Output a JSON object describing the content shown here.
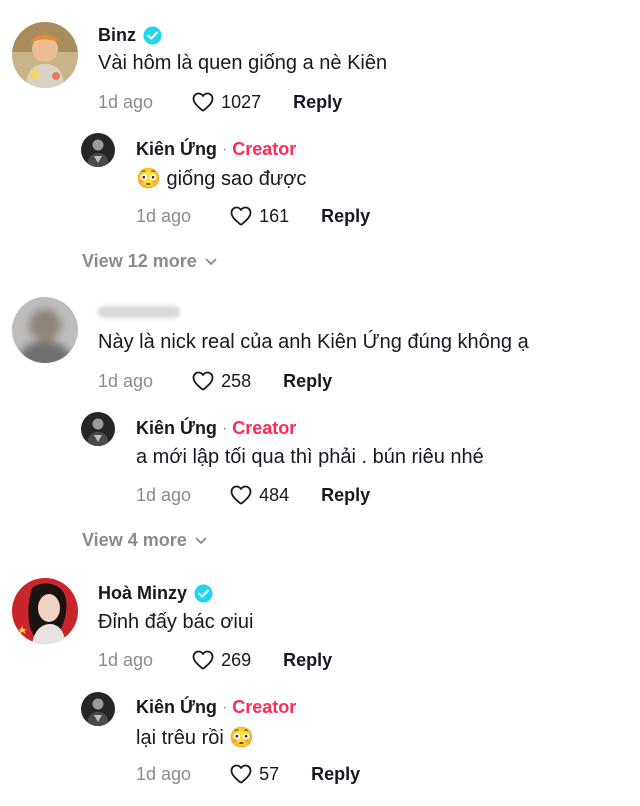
{
  "threads": [
    {
      "comment": {
        "username": "Binz",
        "verified": true,
        "text": "Vài hôm là quen giống a nè Kiên",
        "date": "1d ago",
        "likes": "1027",
        "reply_label": "Reply"
      },
      "reply": {
        "username": "Kiên Ứng",
        "separator": "·",
        "badge": "Creator",
        "emoji": "😳",
        "text": "giống sao được",
        "date": "1d ago",
        "likes": "161",
        "reply_label": "Reply"
      },
      "view_more": "View 12 more"
    },
    {
      "comment": {
        "username": "",
        "text": "Này là nick real của anh Kiên Ứng đúng không ạ",
        "date": "1d ago",
        "likes": "258",
        "reply_label": "Reply"
      },
      "reply": {
        "username": "Kiên Ứng",
        "separator": "·",
        "badge": "Creator",
        "text": "a mới lập tối qua thì phải . bún riêu nhé",
        "date": "1d ago",
        "likes": "484",
        "reply_label": "Reply"
      },
      "view_more": "View 4 more"
    },
    {
      "comment": {
        "username": "Hoà Minzy",
        "verified": true,
        "text": "Đỉnh đấy bác ơiui",
        "date": "1d ago",
        "likes": "269",
        "reply_label": "Reply"
      },
      "reply": {
        "username": "Kiên Ứng",
        "separator": "·",
        "badge": "Creator",
        "text": "lại trêu rồi",
        "emoji": "😳",
        "date": "1d ago",
        "likes": "57",
        "reply_label": "Reply"
      }
    }
  ],
  "colors": {
    "creator": "#fe2c55",
    "verified": "#20d5ec",
    "muted": "#8a8b91",
    "text": "#161823"
  },
  "icons": {
    "verified": "verified-badge-icon",
    "like": "heart-outline-icon",
    "expand": "chevron-down-icon"
  }
}
